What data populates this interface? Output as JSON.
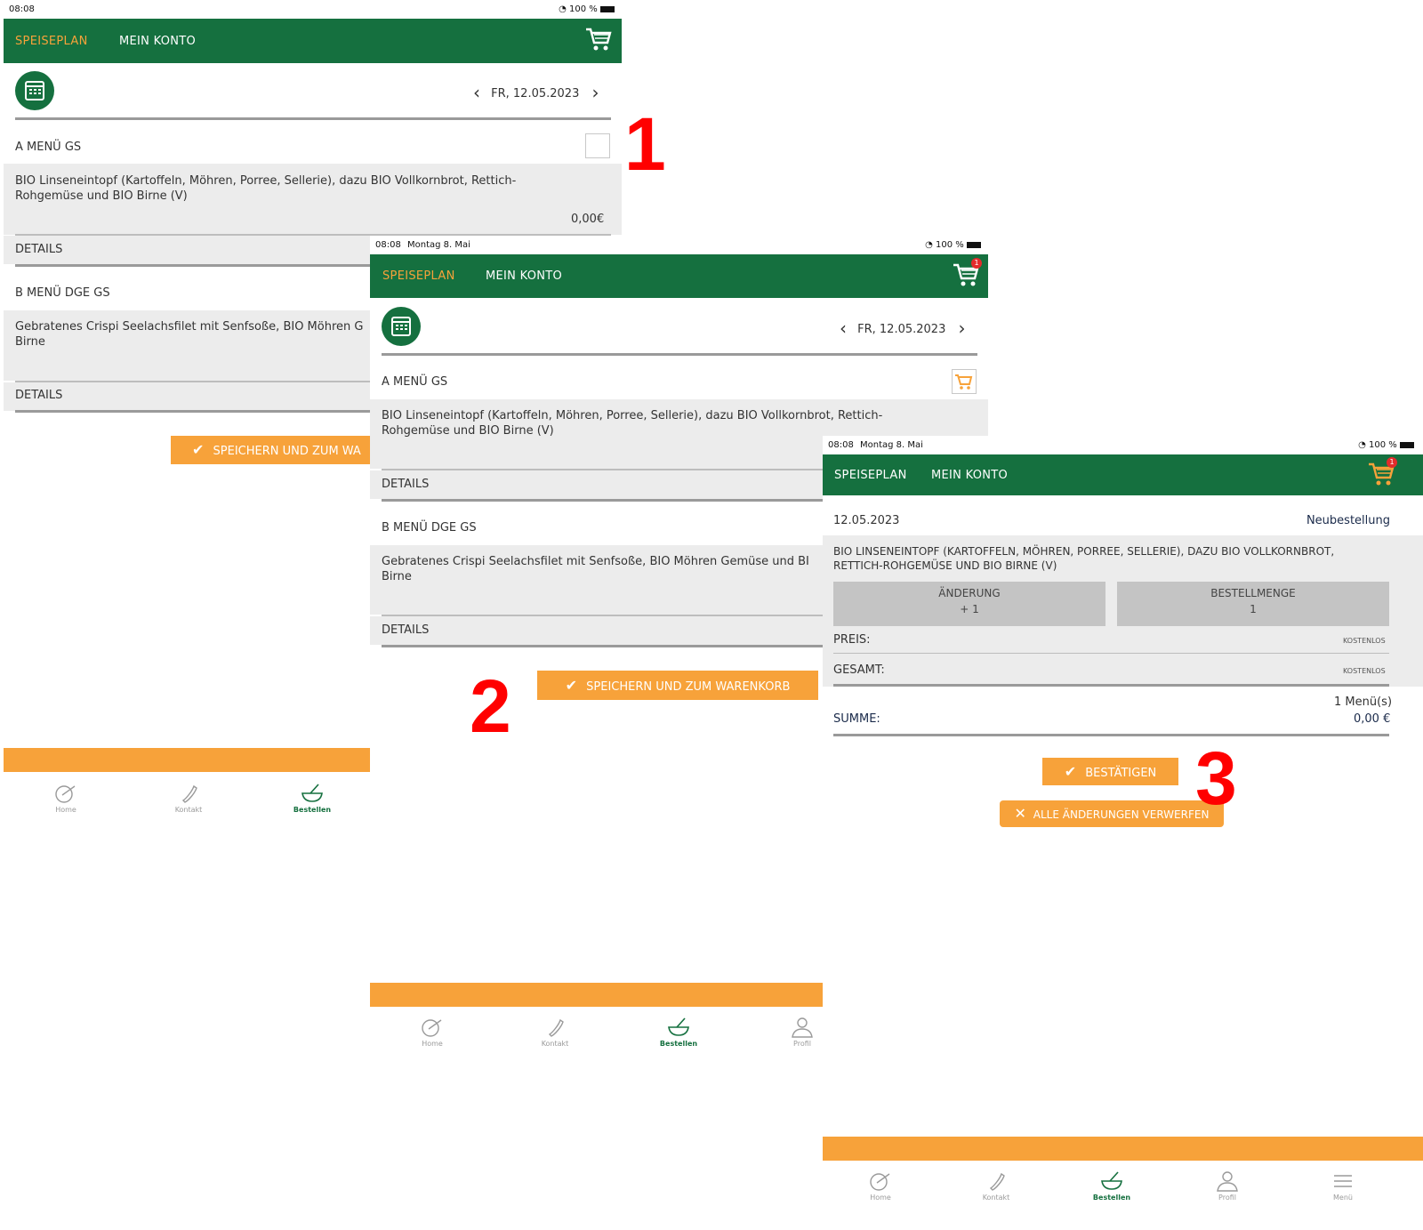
{
  "colors": {
    "green": "#15703f",
    "orange": "#f7a23a",
    "gray_box": "#ececec",
    "red": "#ff0000"
  },
  "step_numbers": [
    "1",
    "2",
    "3"
  ],
  "screen1": {
    "status": {
      "time": "08:08",
      "battery": "100 %"
    },
    "nav": {
      "speiseplan": "SPEISEPLAN",
      "mein_konto": "MEIN KONTO"
    },
    "date": "FR, 12.05.2023",
    "menu_a": {
      "title": "A MENÜ GS",
      "line1": "BIO Linseneintopf (Kartoffeln, Möhren, Porree, Sellerie), dazu BIO Vollkornbrot, Rettich-",
      "line2": "Rohgemüse und BIO Birne (V)",
      "price": "0,00€",
      "details": "DETAILS"
    },
    "menu_b": {
      "title": "B MENÜ DGE GS",
      "line1": "Gebratenes Crispi Seelachsfilet mit Senfsoße, BIO Möhren G",
      "line2": "Birne",
      "details": "DETAILS"
    },
    "save_button": "SPEICHERN UND ZUM WA",
    "tabs": {
      "home": "Home",
      "kontakt": "Kontakt",
      "bestellen": "Bestellen"
    }
  },
  "screen2": {
    "status": {
      "time": "08:08",
      "date": "Montag 8. Mai",
      "battery": "100 %"
    },
    "nav": {
      "speiseplan": "SPEISEPLAN",
      "mein_konto": "MEIN KONTO"
    },
    "cart_badge": "1",
    "date": "FR, 12.05.2023",
    "menu_a": {
      "title": "A MENÜ GS",
      "line1": "BIO Linseneintopf (Kartoffeln, Möhren, Porree, Sellerie), dazu BIO Vollkornbrot, Rettich-",
      "line2": "Rohgemüse und BIO Birne (V)",
      "details": "DETAILS"
    },
    "menu_b": {
      "title": "B MENÜ DGE GS",
      "line1": "Gebratenes Crispi Seelachsfilet mit Senfsoße, BIO Möhren Gemüse und BI",
      "line2": "Birne",
      "details": "DETAILS"
    },
    "save_button": "SPEICHERN UND ZUM WARENKORB",
    "tabs": {
      "home": "Home",
      "kontakt": "Kontakt",
      "bestellen": "Bestellen",
      "profil": "Profil"
    }
  },
  "screen3": {
    "status": {
      "time": "08:08",
      "date": "Montag 8. Mai",
      "battery": "100 %"
    },
    "nav": {
      "speiseplan": "SPEISEPLAN",
      "mein_konto": "MEIN KONTO"
    },
    "cart_badge": "1",
    "order_date": "12.05.2023",
    "order_type": "Neubestellung",
    "item_line1": "BIO LINSENEINTOPF (KARTOFFELN, MÖHREN, PORREE, SELLERIE), DAZU BIO VOLLKORNBROT,",
    "item_line2": "RETTICH-ROHGEMÜSE UND BIO BIRNE (V)",
    "change_label": "ÄNDERUNG",
    "change_value": "+ 1",
    "qty_label": "BESTELLMENGE",
    "qty_value": "1",
    "price_label": "PREIS:",
    "price_value": "KOSTENLOS",
    "total_label": "GESAMT:",
    "total_value": "KOSTENLOS",
    "menus_count": "1 Menü(s)",
    "sum_label": "SUMME:",
    "sum_value": "0,00 €",
    "confirm_button": "BESTÄTIGEN",
    "discard_button": "ALLE ÄNDERUNGEN VERWERFEN",
    "tabs": {
      "home": "Home",
      "kontakt": "Kontakt",
      "bestellen": "Bestellen",
      "profil": "Profil",
      "menu": "Menü"
    }
  }
}
